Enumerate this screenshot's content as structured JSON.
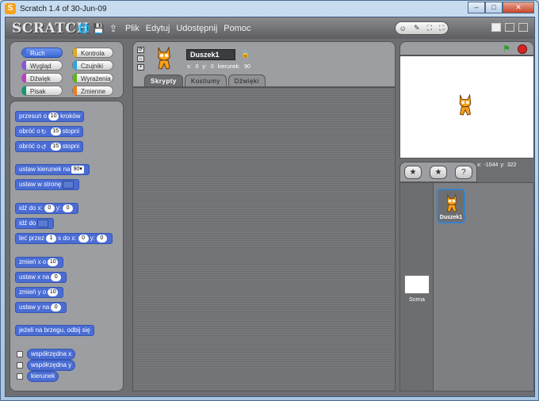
{
  "window": {
    "title": "Scratch 1.4 of 30-Jun-09",
    "min": "–",
    "max": "□",
    "close": "✕"
  },
  "topbar": {
    "logo": "SCRATCH",
    "menu": [
      "Plik",
      "Edytuj",
      "Udostępnij",
      "Pomoc"
    ],
    "view_icons": [
      "☺",
      "✎",
      "⛶",
      "⛶"
    ]
  },
  "categories": [
    {
      "label": "Ruch",
      "color": "#4a6cd4",
      "selected": true
    },
    {
      "label": "Kontrola",
      "color": "#e1a91a"
    },
    {
      "label": "Wygląd",
      "color": "#8a55d7"
    },
    {
      "label": "Czujniki",
      "color": "#2ca5e2"
    },
    {
      "label": "Dźwięk",
      "color": "#bb42c3"
    },
    {
      "label": "Wyrażenia",
      "color": "#5cb712"
    },
    {
      "label": "Pisak",
      "color": "#0e9a6c"
    },
    {
      "label": "Zmienne",
      "color": "#ee7d16"
    }
  ],
  "blocks": {
    "move": {
      "a": "przesuń o",
      "v": "10",
      "b": "kroków"
    },
    "turn_right": {
      "a": "obróć o",
      "icon": "↻",
      "v": "15",
      "b": "stopni"
    },
    "turn_left": {
      "a": "obróć o",
      "icon": "↺",
      "v": "15",
      "b": "stopni"
    },
    "point_dir": {
      "a": "ustaw kierunek na",
      "v": "90▾"
    },
    "point_towards": {
      "a": "ustaw w stronę"
    },
    "goto_xy": {
      "a": "idź do x:",
      "v1": "0",
      "b": "y:",
      "v2": "0"
    },
    "goto": {
      "a": "idź do"
    },
    "glide": {
      "a": "leć przez",
      "v1": "1",
      "b": "s do x:",
      "v2": "0",
      "c": "y:",
      "v3": "0"
    },
    "change_x": {
      "a": "zmień x o",
      "v": "10"
    },
    "set_x": {
      "a": "ustaw x na",
      "v": "0"
    },
    "change_y": {
      "a": "zmień y o",
      "v": "10"
    },
    "set_y": {
      "a": "ustaw y na",
      "v": "0"
    },
    "bounce": {
      "a": "jeżeli na brzegu, odbij się"
    },
    "xpos": {
      "a": "współrzędna x"
    },
    "ypos": {
      "a": "współrzędna y"
    },
    "direction": {
      "a": "kierunek"
    }
  },
  "sprite": {
    "name": "Duszek1",
    "x_label": "x:",
    "x": "0",
    "y_label": "y:",
    "y": "0",
    "dir_label": "kierunek:",
    "dir": "90",
    "tabs": [
      {
        "label": "Skrypty",
        "active": true
      },
      {
        "label": "Kostiumy"
      },
      {
        "label": "Dźwięki"
      }
    ]
  },
  "stage": {
    "flag": "⚑",
    "mouse_x_label": "x:",
    "mouse_x": "-1044",
    "mouse_y_label": "y:",
    "mouse_y": "322",
    "tools": [
      "★",
      "★",
      "?"
    ]
  },
  "sprites_list": {
    "stage_label": "Scena",
    "items": [
      {
        "name": "Duszek1"
      }
    ]
  }
}
